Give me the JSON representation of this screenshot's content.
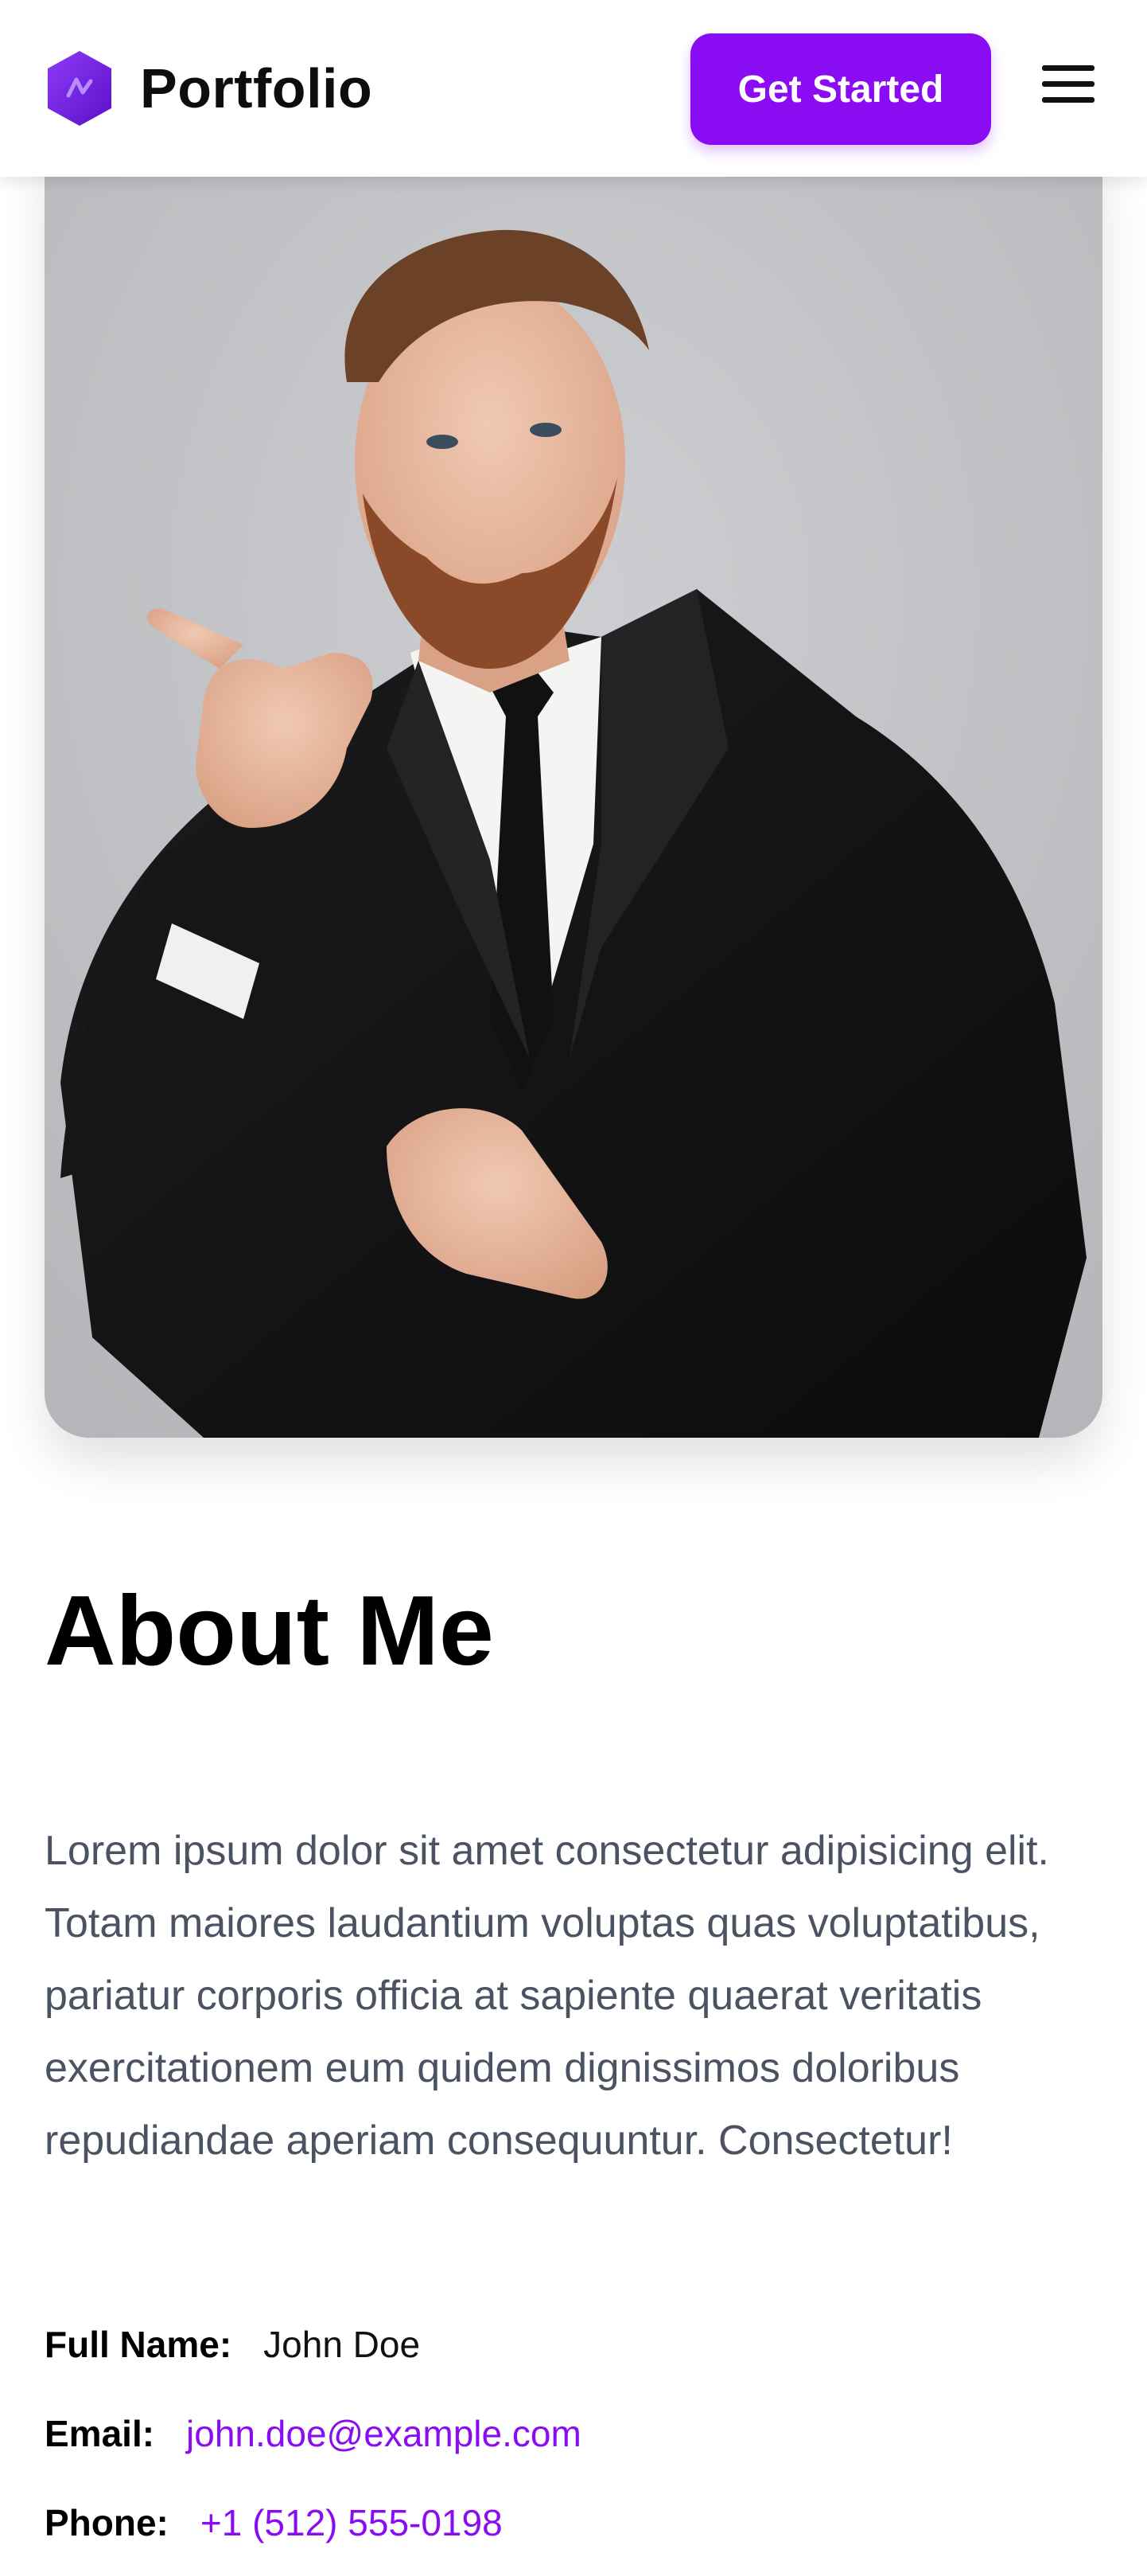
{
  "header": {
    "brand": "Portfolio",
    "cta_label": "Get Started",
    "menu_icon": "hamburger-menu-icon",
    "logo_icon": "hexagon-logo-icon"
  },
  "hero": {
    "image": "portrait-photo-man-in-suit-pointing"
  },
  "about": {
    "title": "About Me",
    "paragraph": "Lorem ipsum dolor sit amet consectetur adipisicing elit. Totam maiores laudantium voluptas quas voluptatibus, pariatur corporis officia at sapiente quaerat veritatis exercitationem eum quidem dignissimos doloribus repudiandae aperiam consequuntur. Consectetur!",
    "details": {
      "name_label": "Full Name:",
      "name_value": "John Doe",
      "email_label": "Email:",
      "email_value": "john.doe@example.com",
      "phone_label": "Phone:",
      "phone_value": "+1 (512) 555-0198"
    }
  },
  "colors": {
    "accent": "#8a0cf3",
    "text_muted": "#4b5363"
  }
}
